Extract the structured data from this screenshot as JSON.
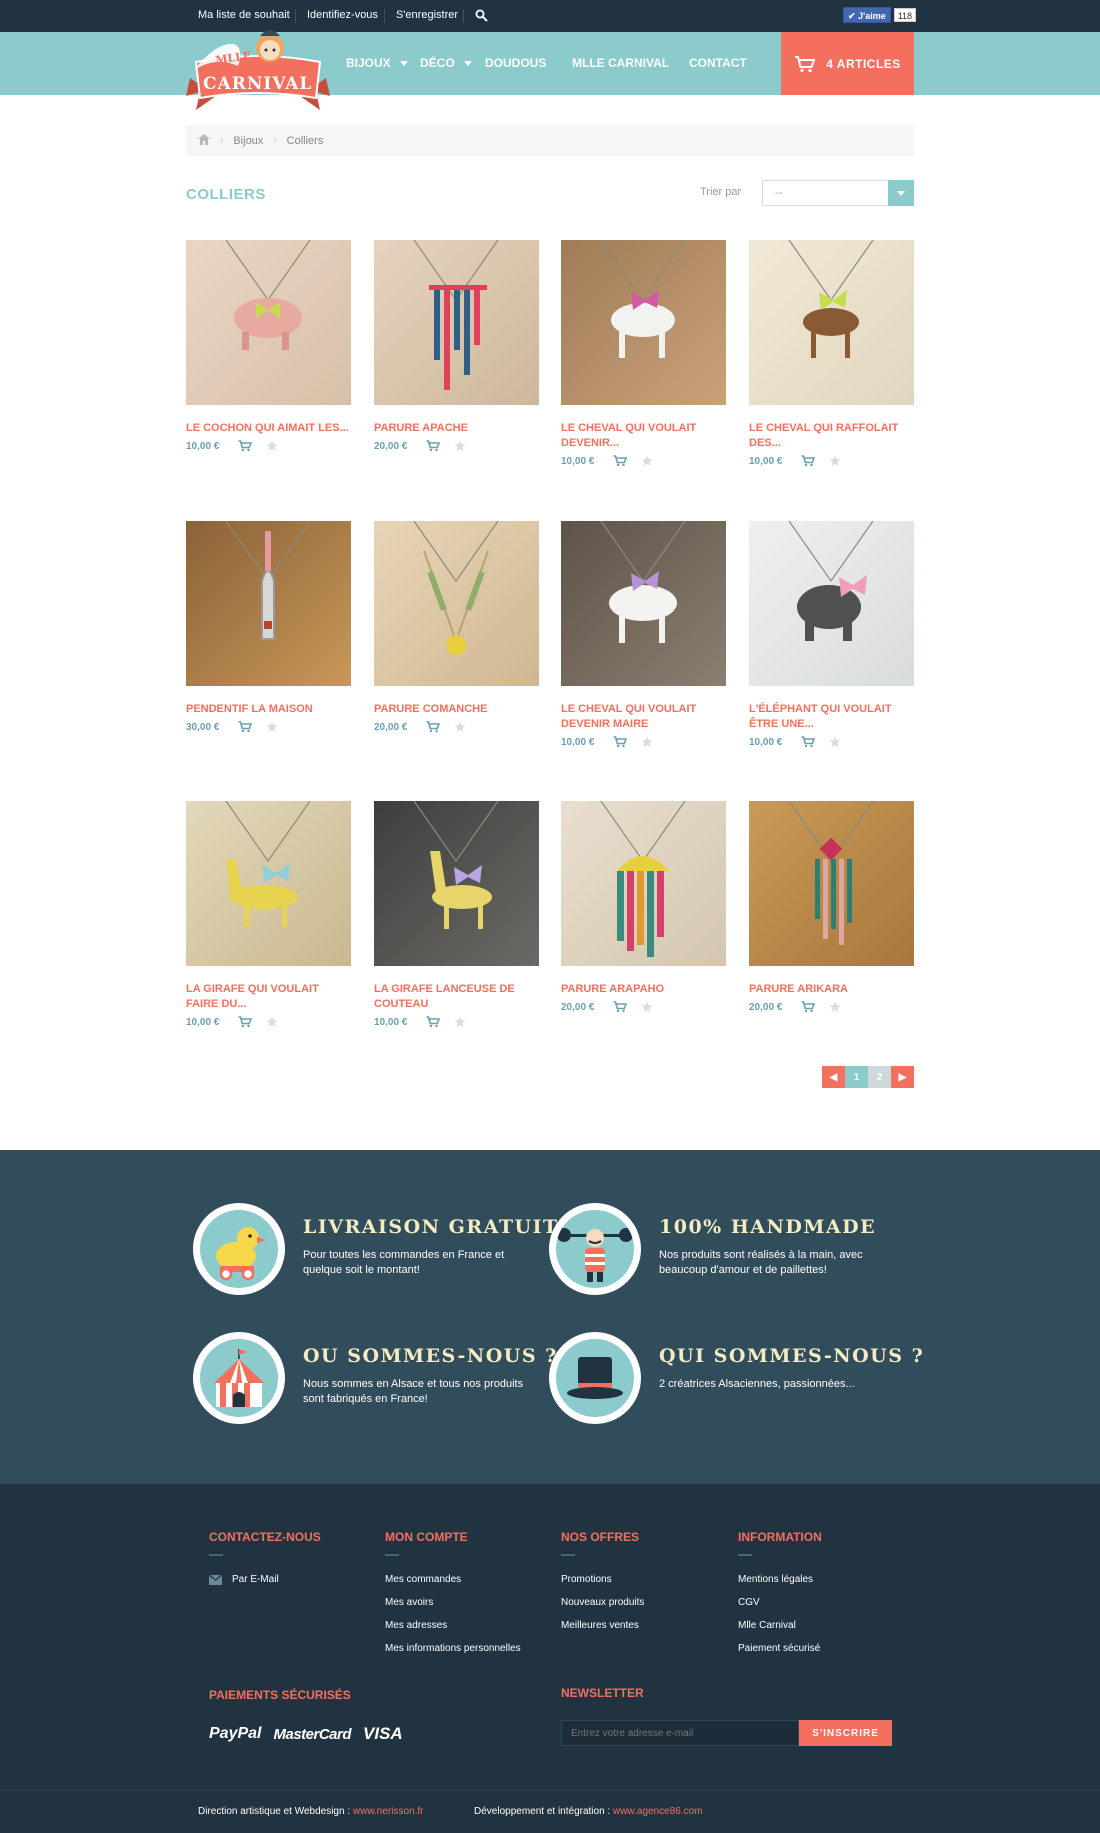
{
  "topbar": {
    "wishlist": "Ma liste de souhait",
    "login": "Identifiez-vous",
    "register": "S'enregistrer",
    "fb_like": "J'aime",
    "fb_count": "118"
  },
  "logo": {
    "line1": "MLLE",
    "line2": "CARNIVAL"
  },
  "nav": [
    {
      "label": "BIJOUX",
      "dropdown": true
    },
    {
      "label": "DÉCO",
      "dropdown": true
    },
    {
      "label": "DOUDOUS",
      "dropdown": false
    },
    {
      "label": "MLLE CARNIVAL",
      "dropdown": false
    },
    {
      "label": "CONTACT",
      "dropdown": false
    }
  ],
  "cart": {
    "label": "4 ARTICLES"
  },
  "breadcrumb": {
    "level1": "Bijoux",
    "level2": "Colliers"
  },
  "category": {
    "title": "COLLIERS",
    "sort_label": "Trier par",
    "sort_value": "--"
  },
  "products": [
    {
      "name": "LE COCHON QUI AIMAIT LES...",
      "price": "10,00 €"
    },
    {
      "name": "PARURE APACHE",
      "price": "20,00 €"
    },
    {
      "name": "LE CHEVAL QUI VOULAIT DEVENIR...",
      "price": "10,00 €"
    },
    {
      "name": "LE CHEVAL QUI RAFFOLAIT DES...",
      "price": "10,00 €"
    },
    {
      "name": "PENDENTIF LA MAISON",
      "price": "30,00 €"
    },
    {
      "name": "PARURE COMANCHE",
      "price": "20,00 €"
    },
    {
      "name": "LE CHEVAL QUI VOULAIT DEVENIR MAIRE",
      "price": "10,00 €"
    },
    {
      "name": "L'ÉLÉPHANT QUI VOULAIT ÊTRE UNE...",
      "price": "10,00 €"
    },
    {
      "name": "LA GIRAFE QUI VOULAIT FAIRE DU...",
      "price": "10,00 €"
    },
    {
      "name": "LA GIRAFE LANCEUSE DE COUTEAU",
      "price": "10,00 €"
    },
    {
      "name": "PARURE ARAPAHO",
      "price": "20,00 €"
    },
    {
      "name": "PARURE ARIKARA",
      "price": "20,00 €"
    }
  ],
  "pagination": {
    "page1": "1",
    "page2": "2"
  },
  "features": [
    {
      "title": "LIVRAISON GRATUITE",
      "text": "Pour toutes les commandes en France et quelque soit le montant!"
    },
    {
      "title": "100% HANDMADE",
      "text": "Nos produits sont réalisés à la main, avec beaucoup d'amour et de paillettes!"
    },
    {
      "title": "OU SOMMES-NOUS ?",
      "text": "Nous sommes en Alsace et tous nos produits sont fabriqués en France!"
    },
    {
      "title": "QUI SOMMES-NOUS ?",
      "text": "2 créatrices Alsaciennes, passionnées..."
    }
  ],
  "footer": {
    "contact": {
      "title": "CONTACTEZ-NOUS",
      "email": "Par E-Mail"
    },
    "account": {
      "title": "MON COMPTE",
      "links": [
        "Mes commandes",
        "Mes avoirs",
        "Mes adresses",
        "Mes informations personnelles"
      ]
    },
    "offers": {
      "title": "NOS OFFRES",
      "links": [
        "Promotions",
        "Nouveaux produits",
        "Meilleures ventes"
      ]
    },
    "info": {
      "title": "INFORMATION",
      "links": [
        "Mentions légales",
        "CGV",
        "Mlle Carnival",
        "Paiement sécurisé"
      ]
    },
    "payments": {
      "title": "PAIEMENTS SÉCURISÉS",
      "paypal": "PayPal",
      "mastercard": "MasterCard",
      "visa": "VISA"
    },
    "newsletter": {
      "title": "NEWSLETTER",
      "placeholder": "Entrez votre adresse e-mail",
      "button": "S'INSCRIRE"
    }
  },
  "credits": {
    "design_label": "Direction artistique et Webdesign :",
    "design_link": "www.nerisson.fr",
    "dev_label": "Développement et intégration :",
    "dev_link": "www.agence86.com"
  },
  "colors": {
    "teal": "#8ccbcb",
    "coral": "#f2705d",
    "navy": "#213340",
    "slate": "#314c5a"
  }
}
